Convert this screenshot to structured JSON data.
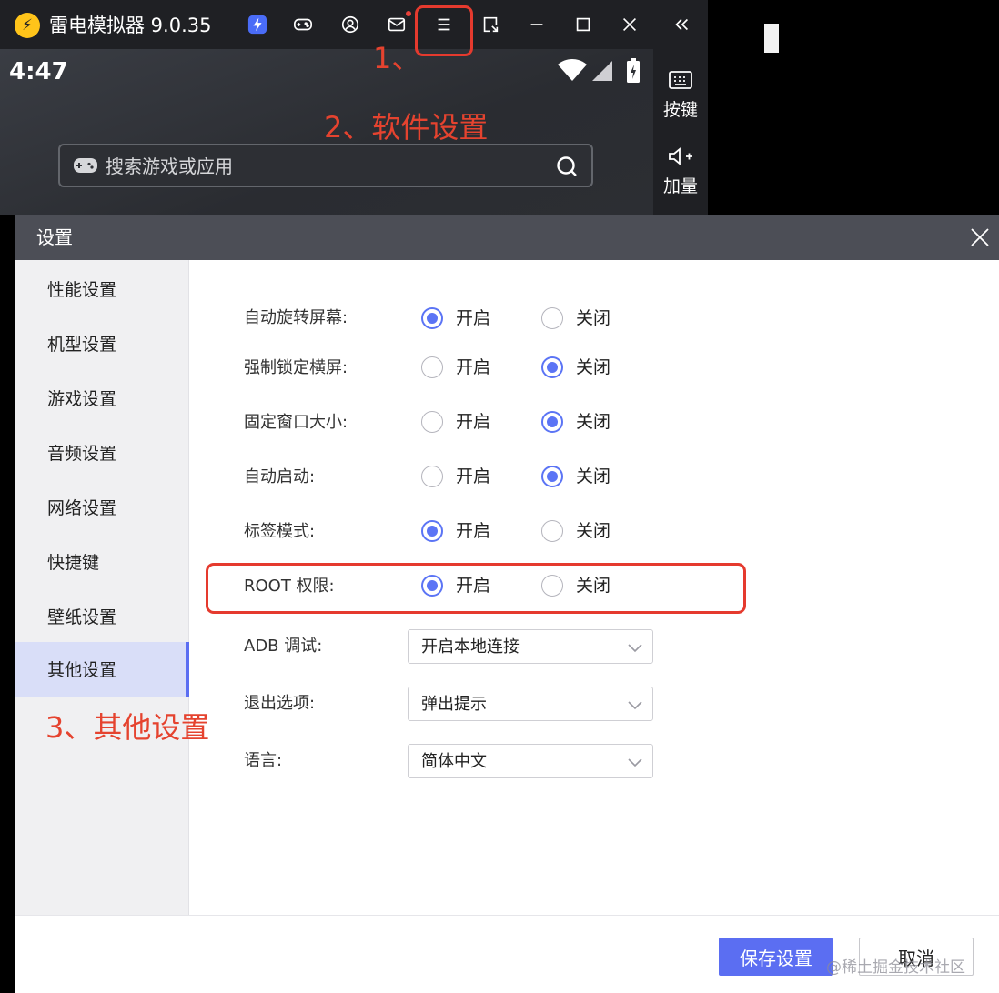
{
  "titlebar": {
    "logo_text": "⚡",
    "app_title": "雷电模拟器 9.0.35",
    "icons": [
      "lightning-icon",
      "gamepad-icon",
      "account-icon",
      "mail-icon",
      "menu-icon",
      "window-icon",
      "minimize-icon",
      "maximize-icon",
      "close-icon",
      "collapse-icon"
    ]
  },
  "phone": {
    "clock": "4:47",
    "search_placeholder": "搜索游戏或应用"
  },
  "rightbar": {
    "items": [
      {
        "label": "按键",
        "icon": "keyboard-icon"
      },
      {
        "label": "加量",
        "icon": "volume-up-icon"
      }
    ]
  },
  "dialog": {
    "title": "设置",
    "sidebar": [
      {
        "label": "性能设置",
        "active": false
      },
      {
        "label": "机型设置",
        "active": false
      },
      {
        "label": "游戏设置",
        "active": false
      },
      {
        "label": "音频设置",
        "active": false
      },
      {
        "label": "网络设置",
        "active": false
      },
      {
        "label": "快捷键",
        "active": false
      },
      {
        "label": "壁纸设置",
        "active": false
      },
      {
        "label": "其他设置",
        "active": true
      }
    ],
    "radio_rows": [
      {
        "label": "自动旋转屏幕:",
        "on_label": "开启",
        "off_label": "关闭",
        "value": "on"
      },
      {
        "label": "强制锁定横屏:",
        "on_label": "开启",
        "off_label": "关闭",
        "value": "off"
      },
      {
        "label": "固定窗口大小:",
        "on_label": "开启",
        "off_label": "关闭",
        "value": "off"
      },
      {
        "label": "自动启动:",
        "on_label": "开启",
        "off_label": "关闭",
        "value": "off"
      },
      {
        "label": "标签模式:",
        "on_label": "开启",
        "off_label": "关闭",
        "value": "on"
      },
      {
        "label": "ROOT 权限:",
        "on_label": "开启",
        "off_label": "关闭",
        "value": "on"
      }
    ],
    "select_rows": [
      {
        "label": "ADB 调试:",
        "value": "开启本地连接"
      },
      {
        "label": "退出选项:",
        "value": "弹出提示"
      },
      {
        "label": "语言:",
        "value": "简体中文"
      }
    ],
    "save_label": "保存设置",
    "cancel_label": "取消",
    "watermark": "@稀土掘金技术社区"
  },
  "annotations": {
    "step1": "1、",
    "step2": "2、软件设置",
    "step3": "3、其他设置",
    "color": "#e53a2e"
  },
  "colors": {
    "accent": "#5b6ef2",
    "radio_checked": "#5b74f5",
    "titlebar_bg": "#1f2024",
    "dialog_header_bg": "#4c4e56"
  }
}
